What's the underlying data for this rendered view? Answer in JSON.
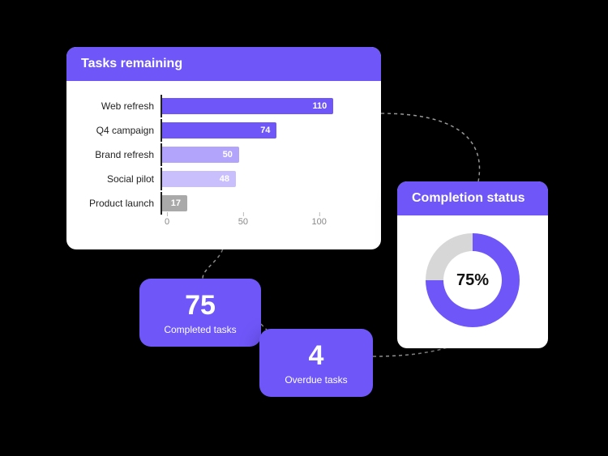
{
  "colors": {
    "primary": "#6E56F8",
    "primaryLight1": "#8E7CF8",
    "primaryLight2": "#B1A4FA",
    "primaryLight3": "#C9BFFD",
    "grey": "#A9A9A9",
    "donutTrack": "#D7D7D7"
  },
  "tasks_card": {
    "title": "Tasks remaining"
  },
  "completion_card": {
    "title": "Completion status",
    "percent_label": "75%",
    "percent": 75
  },
  "stats": {
    "completed": {
      "value": "75",
      "label": "Completed tasks"
    },
    "overdue": {
      "value": "4",
      "label": "Overdue tasks"
    }
  },
  "chart_data": {
    "type": "bar",
    "title": "Tasks remaining",
    "xlabel": "",
    "ylabel": "",
    "xlim": [
      0,
      130
    ],
    "ticks": [
      0,
      50,
      100
    ],
    "categories": [
      "Web refresh",
      "Q4 campaign",
      "Brand refresh",
      "Social pilot",
      "Product launch"
    ],
    "values": [
      110,
      74,
      50,
      48,
      17
    ],
    "bar_colors": [
      "primary",
      "primary",
      "primaryLight2",
      "primaryLight3",
      "grey"
    ]
  }
}
